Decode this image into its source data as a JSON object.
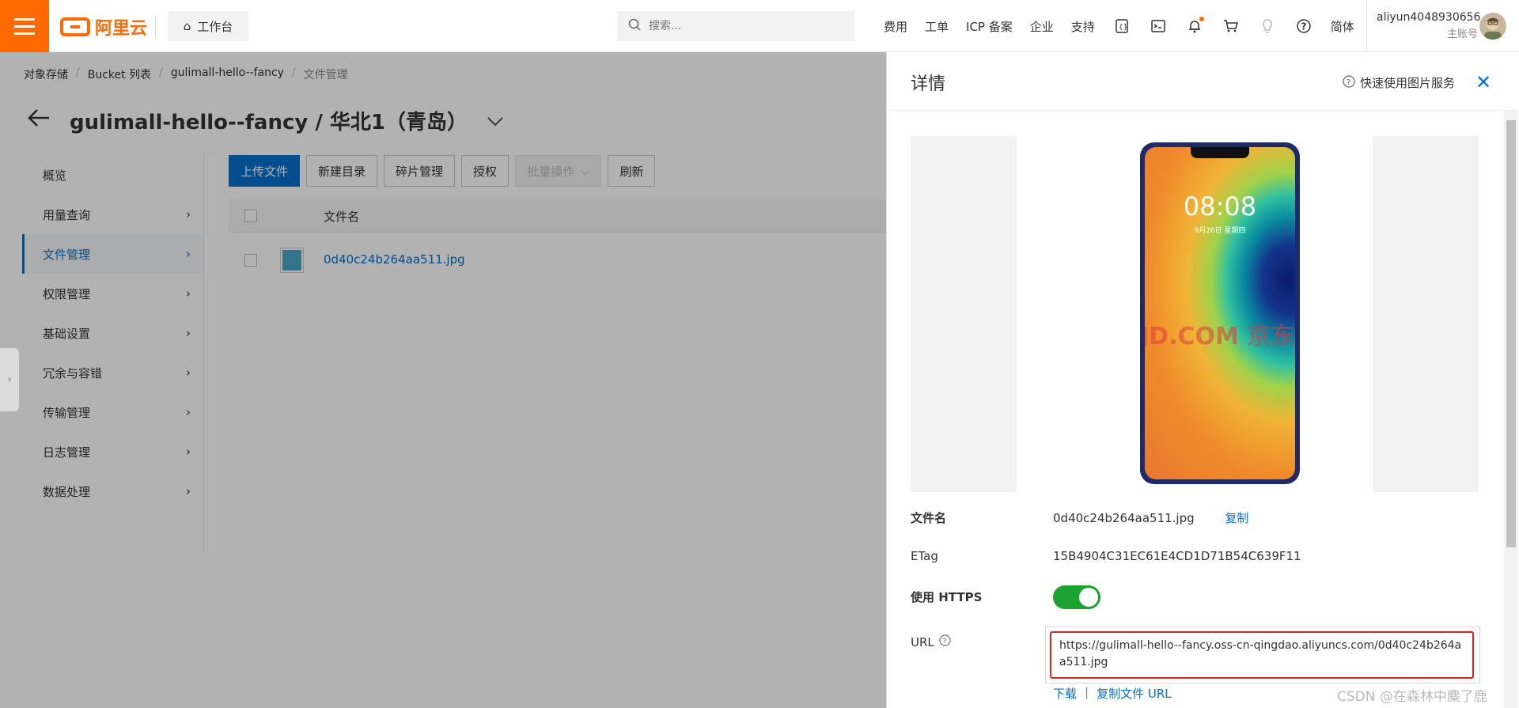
{
  "topbar": {
    "logo_text": "阿里云",
    "workbench_label": "工作台",
    "search_placeholder": "搜索...",
    "nav": [
      "费用",
      "工单",
      "ICP 备案",
      "企业",
      "支持"
    ],
    "lang": "简体",
    "user_name": "aliyun4048930656",
    "user_sub": "主账号",
    "icons": [
      "app-icon",
      "terminal-icon",
      "bell-icon",
      "cart-icon",
      "bulb-icon",
      "help-icon"
    ]
  },
  "breadcrumb": [
    "对象存储",
    "Bucket 列表",
    "gulimall-hello--fancy",
    "文件管理"
  ],
  "page_title": "gulimall-hello--fancy / 华北1（青岛）",
  "sidebar": [
    {
      "label": "概览",
      "arrow": false
    },
    {
      "label": "用量查询",
      "arrow": true
    },
    {
      "label": "文件管理",
      "arrow": true,
      "active": true
    },
    {
      "label": "权限管理",
      "arrow": true
    },
    {
      "label": "基础设置",
      "arrow": true
    },
    {
      "label": "冗余与容错",
      "arrow": true
    },
    {
      "label": "传输管理",
      "arrow": true
    },
    {
      "label": "日志管理",
      "arrow": true
    },
    {
      "label": "数据处理",
      "arrow": true
    }
  ],
  "toolbar": {
    "upload": "上传文件",
    "new_dir": "新建目录",
    "fragments": "碎片管理",
    "authorize": "授权",
    "batch": "批量操作",
    "refresh": "刷新"
  },
  "table": {
    "col_name": "文件名",
    "rows": [
      {
        "name": "0d40c24b264aa511.jpg"
      }
    ]
  },
  "drawer": {
    "title": "详情",
    "help_text": "快速使用图片服务",
    "phone_time": "08:08",
    "phone_date": "9月26日 星期四",
    "watermark": "JD.COM 京东",
    "fields": {
      "filename_label": "文件名",
      "filename_value": "0d40c24b264aa511.jpg",
      "copy_label": "复制",
      "etag_label": "ETag",
      "etag_value": "15B4904C31EC61E4CD1D71B54C639F11",
      "https_label": "使用 HTTPS",
      "https_enabled": true,
      "url_label": "URL",
      "url_value": "https://gulimall-hello--fancy.oss-cn-qingdao.aliyuncs.com/0d40c24b264aa511.jpg",
      "download_label": "下载",
      "copy_url_label": "复制文件 URL",
      "separator": "|"
    }
  },
  "watermark_text": "CSDN @在森林中麋了鹿",
  "colors": {
    "brand": "#ff6a00",
    "primary": "#0070cc",
    "toggle_on": "#1aa32e",
    "highlight": "#e02020"
  }
}
